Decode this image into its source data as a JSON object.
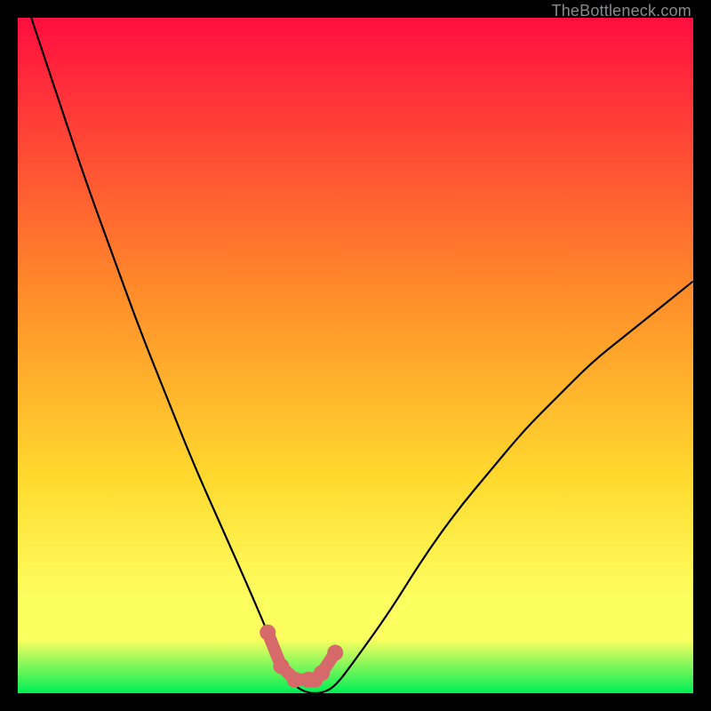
{
  "watermark": "TheBottleneck.com",
  "colors": {
    "bg_black": "#000000",
    "grad_top": "#ff0e3f",
    "grad_mid1": "#ff8a2a",
    "grad_mid2": "#ffd92e",
    "grad_mid3": "#fdff60",
    "grad_bottom": "#00ee55",
    "curve": "#000000",
    "highlight": "#d66a6a"
  },
  "chart_data": {
    "type": "line",
    "title": "",
    "xlabel": "",
    "ylabel": "",
    "xlim": [
      0,
      100
    ],
    "ylim": [
      0,
      100
    ],
    "grid": false,
    "legend": false,
    "series": [
      {
        "name": "bottleneck-curve",
        "x": [
          2,
          6,
          10,
          14,
          18,
          22,
          26,
          30,
          34,
          37,
          39,
          41,
          43,
          45,
          47,
          50,
          55,
          60,
          65,
          70,
          75,
          80,
          85,
          90,
          95,
          100
        ],
        "y": [
          100,
          88,
          76,
          65,
          54,
          44,
          34,
          25,
          16,
          9,
          4,
          1,
          0,
          0,
          1,
          5,
          12,
          20,
          27,
          33,
          39,
          44,
          49,
          53,
          57,
          61
        ]
      }
    ],
    "highlight_region": {
      "name": "optimal-range",
      "x": [
        37,
        39,
        41,
        43,
        44,
        45,
        47
      ],
      "y": [
        9,
        4,
        2,
        2,
        2,
        3,
        6
      ]
    },
    "gradient_bands": [
      {
        "y_start": 100,
        "y_end": 60,
        "from": "#ff0e3f",
        "to": "#ff8a2a"
      },
      {
        "y_start": 60,
        "y_end": 30,
        "from": "#ff8a2a",
        "to": "#ffd92e"
      },
      {
        "y_start": 30,
        "y_end": 8,
        "from": "#ffd92e",
        "to": "#fdff60"
      },
      {
        "y_start": 8,
        "y_end": 0,
        "from": "#fdff60",
        "to": "#00ee55"
      }
    ]
  }
}
